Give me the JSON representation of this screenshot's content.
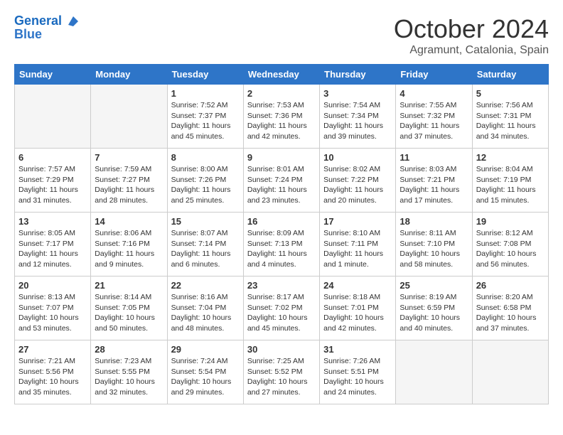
{
  "header": {
    "logo_line1": "General",
    "logo_line2": "Blue",
    "month": "October 2024",
    "location": "Agramunt, Catalonia, Spain"
  },
  "weekdays": [
    "Sunday",
    "Monday",
    "Tuesday",
    "Wednesday",
    "Thursday",
    "Friday",
    "Saturday"
  ],
  "weeks": [
    [
      {
        "day": null
      },
      {
        "day": null
      },
      {
        "day": "1",
        "sunrise": "7:52 AM",
        "sunset": "7:37 PM",
        "daylight": "11 hours and 45 minutes."
      },
      {
        "day": "2",
        "sunrise": "7:53 AM",
        "sunset": "7:36 PM",
        "daylight": "11 hours and 42 minutes."
      },
      {
        "day": "3",
        "sunrise": "7:54 AM",
        "sunset": "7:34 PM",
        "daylight": "11 hours and 39 minutes."
      },
      {
        "day": "4",
        "sunrise": "7:55 AM",
        "sunset": "7:32 PM",
        "daylight": "11 hours and 37 minutes."
      },
      {
        "day": "5",
        "sunrise": "7:56 AM",
        "sunset": "7:31 PM",
        "daylight": "11 hours and 34 minutes."
      }
    ],
    [
      {
        "day": "6",
        "sunrise": "7:57 AM",
        "sunset": "7:29 PM",
        "daylight": "11 hours and 31 minutes."
      },
      {
        "day": "7",
        "sunrise": "7:59 AM",
        "sunset": "7:27 PM",
        "daylight": "11 hours and 28 minutes."
      },
      {
        "day": "8",
        "sunrise": "8:00 AM",
        "sunset": "7:26 PM",
        "daylight": "11 hours and 25 minutes."
      },
      {
        "day": "9",
        "sunrise": "8:01 AM",
        "sunset": "7:24 PM",
        "daylight": "11 hours and 23 minutes."
      },
      {
        "day": "10",
        "sunrise": "8:02 AM",
        "sunset": "7:22 PM",
        "daylight": "11 hours and 20 minutes."
      },
      {
        "day": "11",
        "sunrise": "8:03 AM",
        "sunset": "7:21 PM",
        "daylight": "11 hours and 17 minutes."
      },
      {
        "day": "12",
        "sunrise": "8:04 AM",
        "sunset": "7:19 PM",
        "daylight": "11 hours and 15 minutes."
      }
    ],
    [
      {
        "day": "13",
        "sunrise": "8:05 AM",
        "sunset": "7:17 PM",
        "daylight": "11 hours and 12 minutes."
      },
      {
        "day": "14",
        "sunrise": "8:06 AM",
        "sunset": "7:16 PM",
        "daylight": "11 hours and 9 minutes."
      },
      {
        "day": "15",
        "sunrise": "8:07 AM",
        "sunset": "7:14 PM",
        "daylight": "11 hours and 6 minutes."
      },
      {
        "day": "16",
        "sunrise": "8:09 AM",
        "sunset": "7:13 PM",
        "daylight": "11 hours and 4 minutes."
      },
      {
        "day": "17",
        "sunrise": "8:10 AM",
        "sunset": "7:11 PM",
        "daylight": "11 hours and 1 minute."
      },
      {
        "day": "18",
        "sunrise": "8:11 AM",
        "sunset": "7:10 PM",
        "daylight": "10 hours and 58 minutes."
      },
      {
        "day": "19",
        "sunrise": "8:12 AM",
        "sunset": "7:08 PM",
        "daylight": "10 hours and 56 minutes."
      }
    ],
    [
      {
        "day": "20",
        "sunrise": "8:13 AM",
        "sunset": "7:07 PM",
        "daylight": "10 hours and 53 minutes."
      },
      {
        "day": "21",
        "sunrise": "8:14 AM",
        "sunset": "7:05 PM",
        "daylight": "10 hours and 50 minutes."
      },
      {
        "day": "22",
        "sunrise": "8:16 AM",
        "sunset": "7:04 PM",
        "daylight": "10 hours and 48 minutes."
      },
      {
        "day": "23",
        "sunrise": "8:17 AM",
        "sunset": "7:02 PM",
        "daylight": "10 hours and 45 minutes."
      },
      {
        "day": "24",
        "sunrise": "8:18 AM",
        "sunset": "7:01 PM",
        "daylight": "10 hours and 42 minutes."
      },
      {
        "day": "25",
        "sunrise": "8:19 AM",
        "sunset": "6:59 PM",
        "daylight": "10 hours and 40 minutes."
      },
      {
        "day": "26",
        "sunrise": "8:20 AM",
        "sunset": "6:58 PM",
        "daylight": "10 hours and 37 minutes."
      }
    ],
    [
      {
        "day": "27",
        "sunrise": "7:21 AM",
        "sunset": "5:56 PM",
        "daylight": "10 hours and 35 minutes."
      },
      {
        "day": "28",
        "sunrise": "7:23 AM",
        "sunset": "5:55 PM",
        "daylight": "10 hours and 32 minutes."
      },
      {
        "day": "29",
        "sunrise": "7:24 AM",
        "sunset": "5:54 PM",
        "daylight": "10 hours and 29 minutes."
      },
      {
        "day": "30",
        "sunrise": "7:25 AM",
        "sunset": "5:52 PM",
        "daylight": "10 hours and 27 minutes."
      },
      {
        "day": "31",
        "sunrise": "7:26 AM",
        "sunset": "5:51 PM",
        "daylight": "10 hours and 24 minutes."
      },
      {
        "day": null
      },
      {
        "day": null
      }
    ]
  ]
}
